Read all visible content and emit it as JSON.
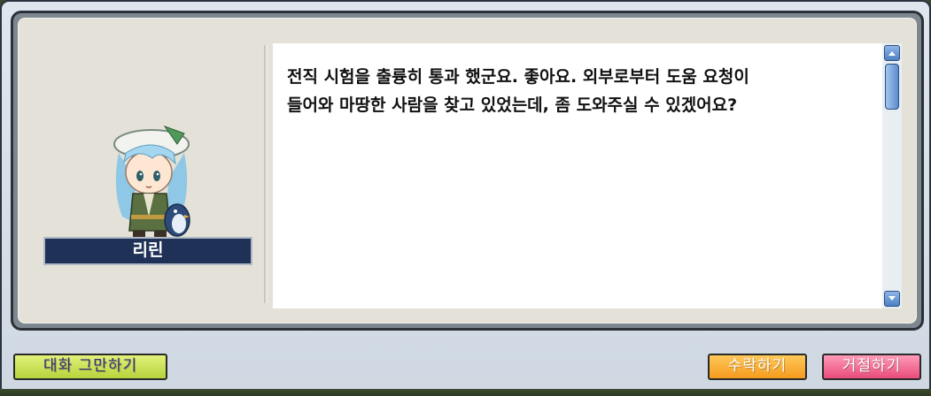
{
  "npc": {
    "name": "리린",
    "portrait": "npc-lilin-portrait"
  },
  "dialogue": {
    "line1": "전직 시험을 출륭히 통과 했군요. 좋아요. 외부로부터 도움 요청이",
    "line2": "들어와 마땅한 사람을 찾고 있었는데, 좀 도와주실 수 있겠어요?"
  },
  "buttons": {
    "end_chat": "대화 그만하기",
    "accept": "수락하기",
    "decline": "거절하기"
  },
  "icons": {
    "scroll_up": "scroll-up-arrow-icon",
    "scroll_down": "scroll-down-arrow-icon"
  },
  "colors": {
    "nameplate": "#1f3156",
    "end_button": "#c8e050",
    "accept_button": "#f7a52a",
    "decline_button": "#f06a90",
    "scroll_thumb": "#5a8cd0"
  }
}
